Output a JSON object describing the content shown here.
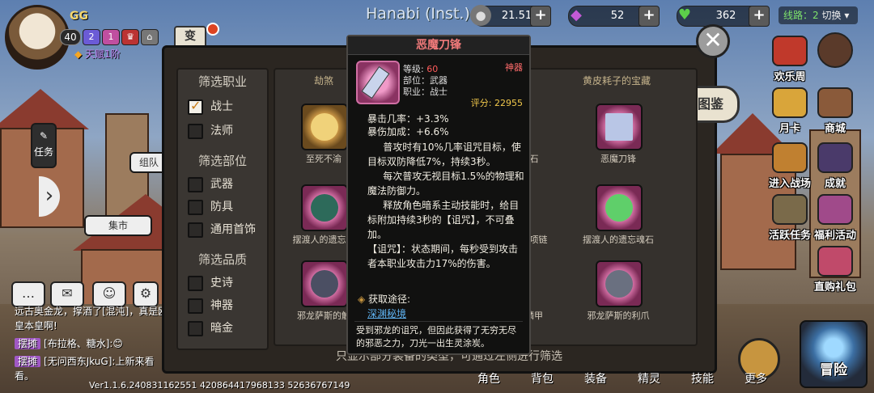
{
  "player": {
    "name": "GG",
    "level": "40",
    "change_label": "变",
    "talent": "天赋1阶",
    "badges": [
      "2",
      "1"
    ]
  },
  "header": {
    "server_title": "Hanabi (Inst.)",
    "resources": [
      {
        "name": "gold",
        "icon": "coin-icon",
        "value": "21.51万"
      },
      {
        "name": "gem",
        "icon": "diamond-icon",
        "value": "52"
      },
      {
        "name": "stamina",
        "icon": "heart-icon",
        "value": "362"
      }
    ],
    "line_label": "线路：",
    "line_value": "2",
    "switch_label": "切换"
  },
  "left_hud": {
    "task_label": "任务",
    "team_label": "组队",
    "market_label": "集市"
  },
  "chat": {
    "lines": [
      {
        "tag": "",
        "text": "远古奥金龙，撑酒了[混沌]，真是欧皇本皇啊!"
      },
      {
        "tag": "摆摊",
        "text": "[布拉格、糖水]:😊"
      },
      {
        "tag": "摆摊",
        "text": "[无问西东JkuG]:上新来看看。"
      }
    ]
  },
  "version": "Ver1.1.6.240831162551   420864417968133   52636767149",
  "filters": {
    "class_title": "筛选职业",
    "class_items": [
      {
        "label": "战士",
        "checked": true
      },
      {
        "label": "法师",
        "checked": false
      }
    ],
    "part_title": "筛选部位",
    "part_items": [
      {
        "label": "武器",
        "checked": false
      },
      {
        "label": "防具",
        "checked": false
      },
      {
        "label": "通用首饰",
        "checked": false
      }
    ],
    "quality_title": "筛选品质",
    "quality_items": [
      {
        "label": "史诗",
        "checked": false
      },
      {
        "label": "神器",
        "checked": false
      },
      {
        "label": "暗金",
        "checked": false
      }
    ]
  },
  "grid": {
    "col_heads": [
      "劫煞",
      "黄皮耗子的宝藏"
    ],
    "items": [
      {
        "label": "至死不渝",
        "style": "gold"
      },
      {
        "label": "石",
        "style": "gold"
      },
      {
        "label": "恶魔刀锋",
        "style": "pink"
      },
      {
        "label": "摆渡人的遗忘手",
        "style": "pink"
      },
      {
        "label": "忘项链",
        "style": "pink"
      },
      {
        "label": "摆渡人的遗忘魂石",
        "style": "pink"
      },
      {
        "label": "邪龙萨斯的触",
        "style": "pink"
      },
      {
        "label": "鳞甲",
        "style": "pink"
      },
      {
        "label": "邪龙萨斯的利爪",
        "style": "pink"
      }
    ],
    "hint": "只显示部分装备的类型，可通过左侧进行筛选"
  },
  "tujian_label": "图鉴",
  "right_menu": [
    "欢乐周",
    "月卡",
    "商城",
    "进入战场",
    "成就",
    "活跃任务",
    "福利活动",
    "直购礼包"
  ],
  "bottom_nav": [
    "角色",
    "背包",
    "装备",
    "精灵",
    "技能",
    "更多"
  ],
  "adventure_label": "冒险",
  "tooltip": {
    "title": "恶魔刀锋",
    "level_label": "等级:",
    "level_value": "60",
    "part": "部位：武器",
    "class": "职业：战士",
    "rarity": "神器",
    "score_label": "评分:",
    "score_value": "22955",
    "stats": [
      "暴击几率：+3.3%",
      "暴伤加成：+6.6%"
    ],
    "desc1": "普攻时有10%几率诅咒目标，使目标双防降低7%，持续3秒。",
    "desc2": "每次普攻无视目标1.5%的物理和魔法防御力。",
    "desc3": "释放角色暗系主动技能时，给目标附加持续3秒的【诅咒】，不可叠加。",
    "desc4": "【诅咒】：状态期间，每秒受到攻击者本职业攻击力17%的伤害。",
    "source_label": "获取途径:",
    "source_link": "深渊秘境",
    "flavor": "受到邪龙的诅咒，但因此获得了无穷无尽的邪恶之力，刀光一出生灵涂炭。"
  },
  "colors": {
    "tooltip_title": "#f07a7a",
    "rarity": "#ff6b6b",
    "score": "#f2c94c",
    "link": "#5fb3f2",
    "line_value": "#7ee36b"
  }
}
